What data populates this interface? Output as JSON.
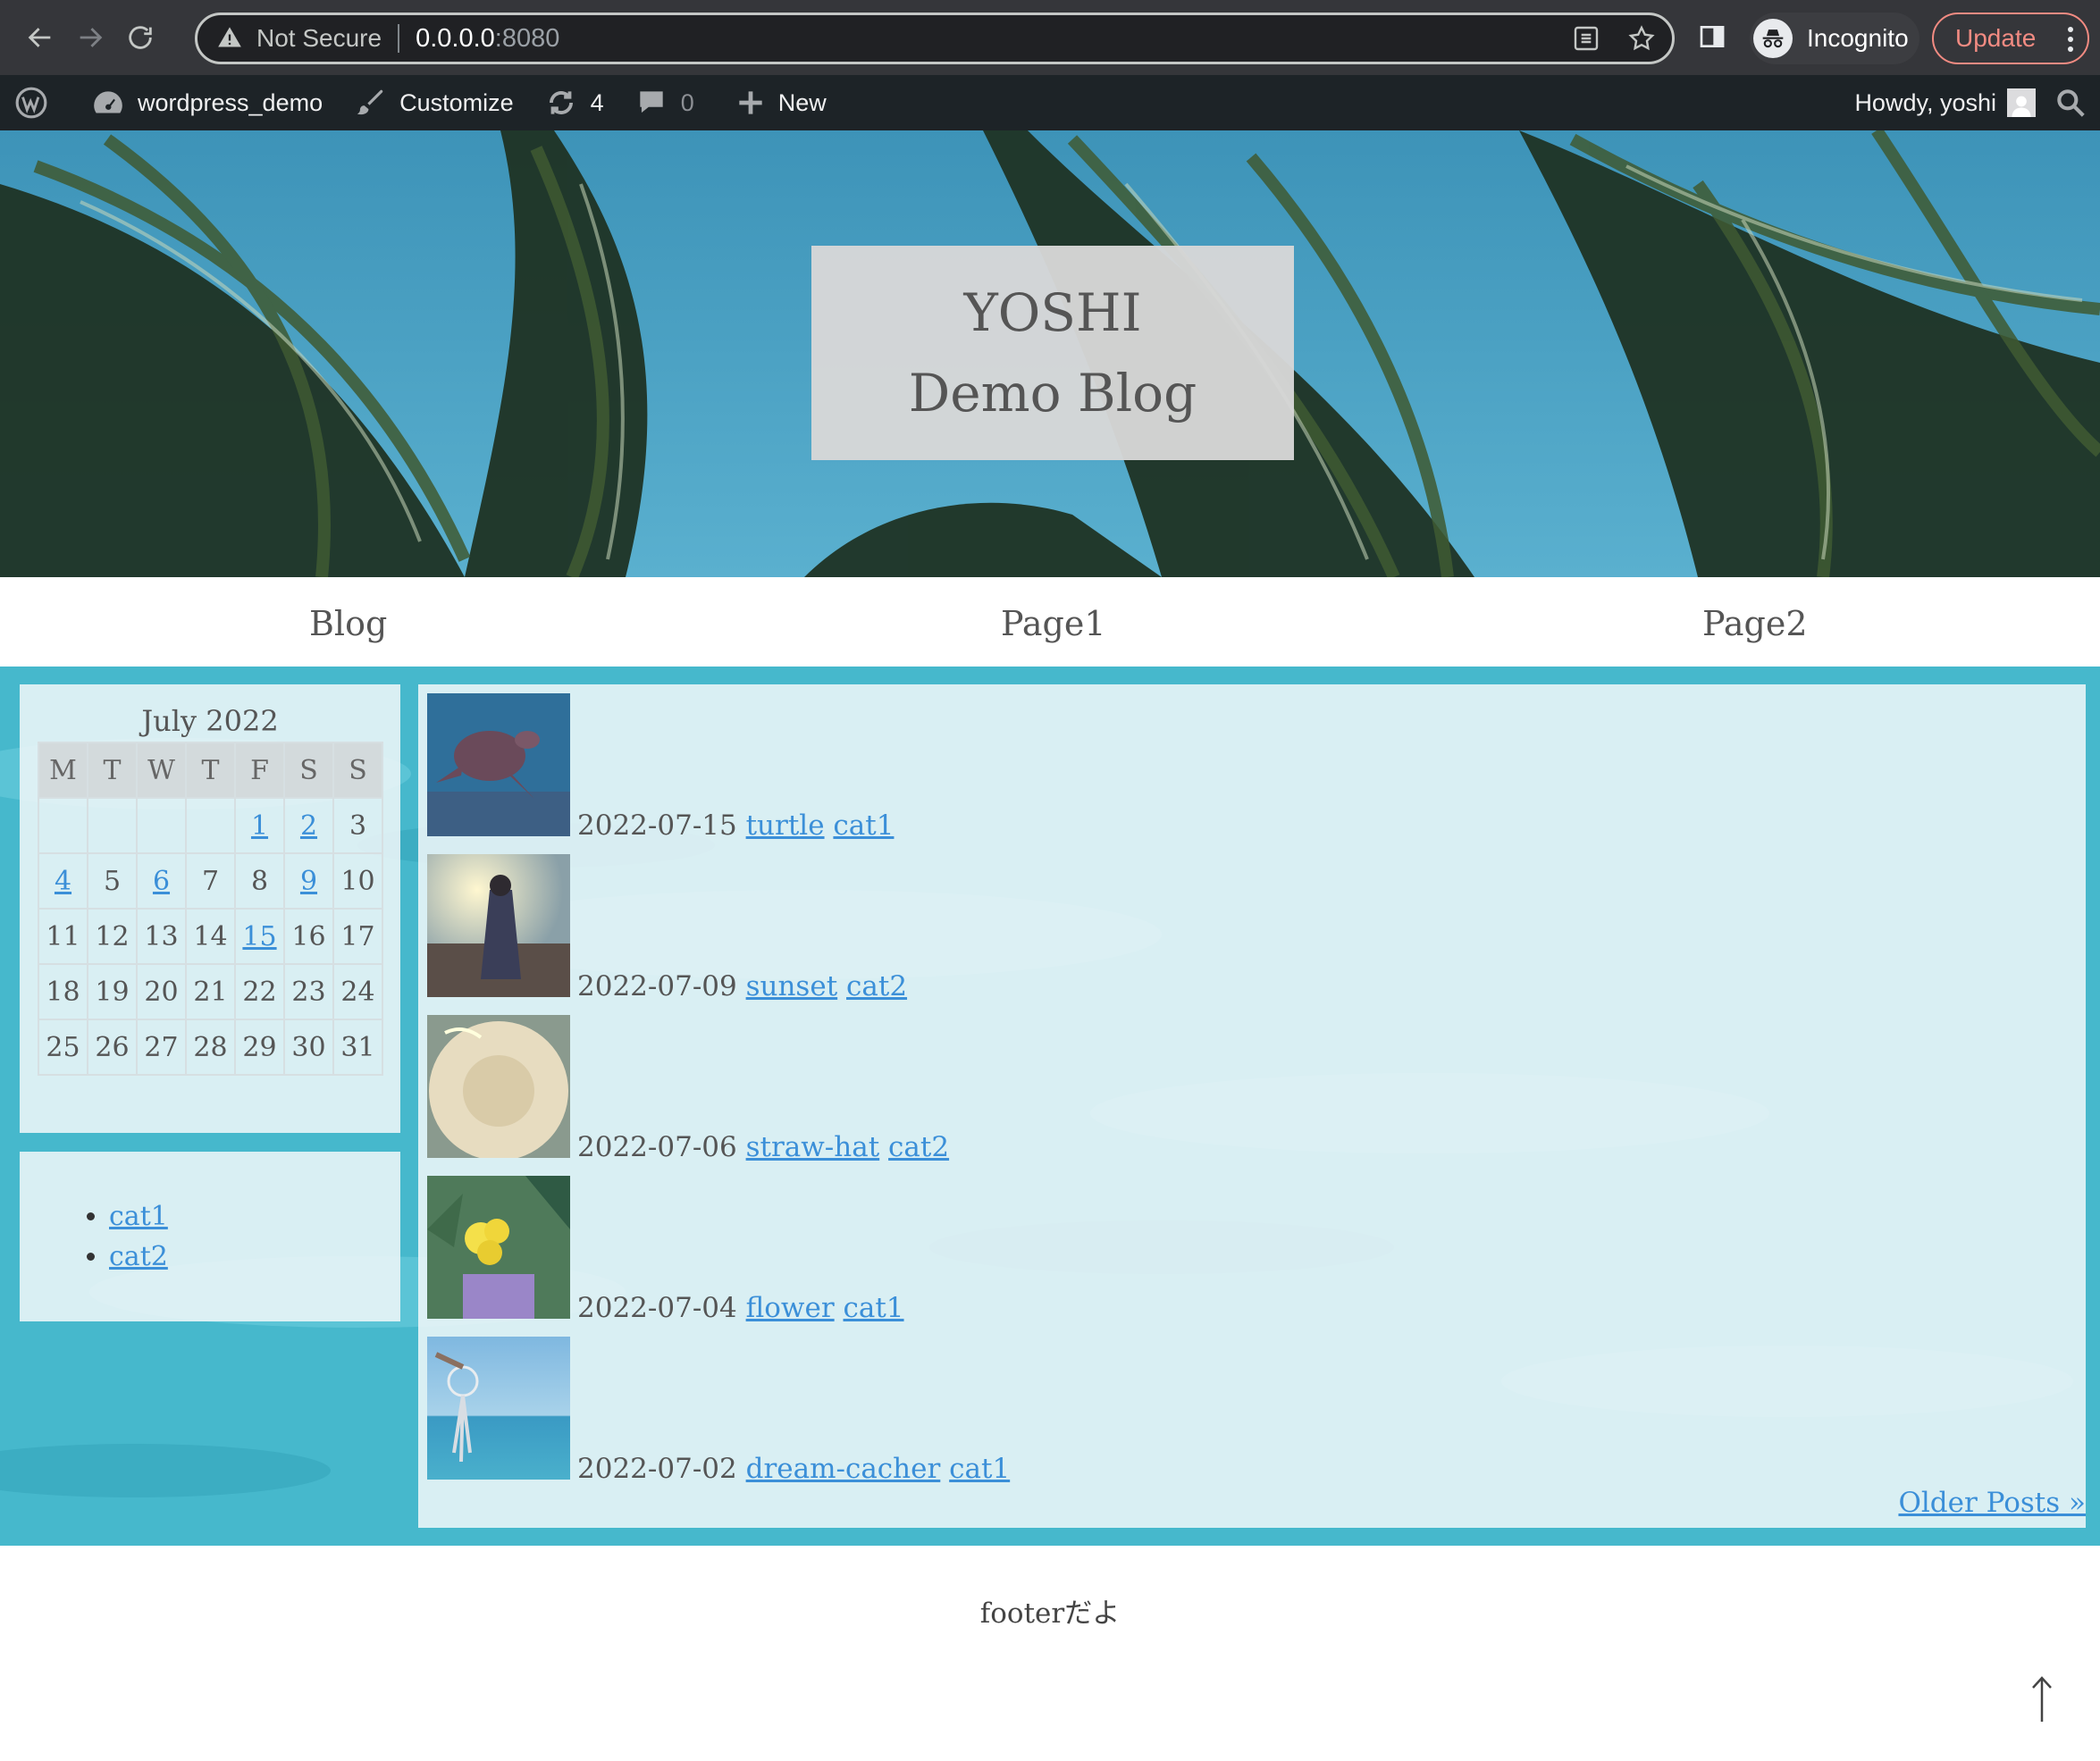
{
  "browser": {
    "not_secure": "Not Secure",
    "url_host": "0.0.0.0",
    "url_port": ":8080",
    "incognito_label": "Incognito",
    "update_label": "Update"
  },
  "admin_bar": {
    "site_name": "wordpress_demo",
    "customize": "Customize",
    "updates_count": "4",
    "comments_count": "0",
    "new_label": "New",
    "howdy": "Howdy, yoshi"
  },
  "site": {
    "title_line1": "YOSHI",
    "title_line2": "Demo Blog"
  },
  "nav": {
    "items": [
      "Blog",
      "Page1",
      "Page2"
    ]
  },
  "calendar": {
    "caption": "July 2022",
    "weekdays": [
      "M",
      "T",
      "W",
      "T",
      "F",
      "S",
      "S"
    ],
    "weeks": [
      [
        "",
        "",
        "",
        "",
        "1",
        "2",
        "3"
      ],
      [
        "4",
        "5",
        "6",
        "7",
        "8",
        "9",
        "10"
      ],
      [
        "11",
        "12",
        "13",
        "14",
        "15",
        "16",
        "17"
      ],
      [
        "18",
        "19",
        "20",
        "21",
        "22",
        "23",
        "24"
      ],
      [
        "25",
        "26",
        "27",
        "28",
        "29",
        "30",
        "31"
      ]
    ],
    "linked_days": [
      "1",
      "2",
      "4",
      "6",
      "9",
      "15"
    ]
  },
  "categories": [
    "cat1",
    "cat2"
  ],
  "posts": [
    {
      "date": "2022-07-15",
      "title": "turtle",
      "category": "cat1",
      "thumb": "turtle"
    },
    {
      "date": "2022-07-09",
      "title": "sunset",
      "category": "cat2",
      "thumb": "sunset"
    },
    {
      "date": "2022-07-06",
      "title": "straw-hat",
      "category": "cat2",
      "thumb": "straw-hat"
    },
    {
      "date": "2022-07-04",
      "title": "flower",
      "category": "cat1",
      "thumb": "flower"
    },
    {
      "date": "2022-07-02",
      "title": "dream-cacher",
      "category": "cat1",
      "thumb": "dream-catcher"
    }
  ],
  "pagination": {
    "older": "Older Posts »"
  },
  "footer": {
    "text": "footerだよ",
    "to_top": "↑"
  },
  "colors": {
    "link": "#3b8fd8",
    "admin_bar": "#1d2327",
    "chrome": "#35363a",
    "update_accent": "#f28b82"
  }
}
